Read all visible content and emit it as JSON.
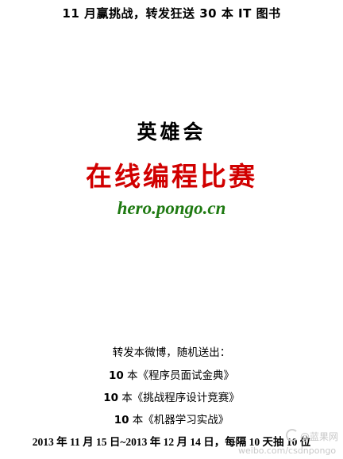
{
  "header": {
    "title": "11 月赢挑战，转发狂送 30 本 IT 图书"
  },
  "poster": {
    "brand": "英雄会",
    "contest": "在线编程比赛",
    "url": "hero.pongo.cn"
  },
  "giveaway": {
    "intro": "转发本微博，随机送出：",
    "books": [
      {
        "count": "10",
        "rest": " 本《程序员面试金典》"
      },
      {
        "count": "10",
        "rest": " 本《挑战程序设计竞赛》"
      },
      {
        "count": "10",
        "rest": " 本《机器学习实战》"
      }
    ],
    "schedule": "2013 年 11 月 15 日~2013 年 12 月 14 日，每隔 10 天抽 10 位"
  },
  "watermark": {
    "logo_text": "@蓝果网",
    "url_text": "weibo.com/csdnpongo"
  },
  "colors": {
    "text": "#000000",
    "contest": "#d10000",
    "url": "#1f7a12",
    "watermark": "#c8c8c8"
  }
}
